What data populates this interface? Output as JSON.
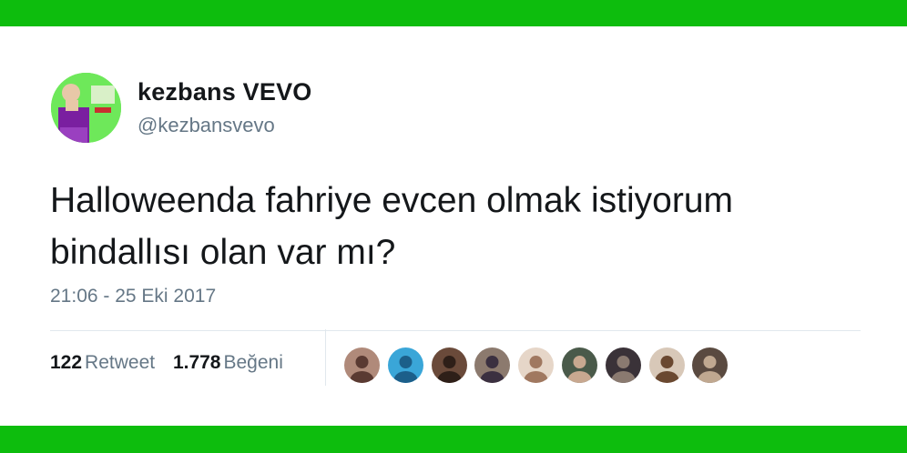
{
  "colors": {
    "band": "#0dbd0d",
    "text_primary": "#14171a",
    "text_secondary": "#657786",
    "divider": "#e1e8ed"
  },
  "user": {
    "display_name": "kezbans VEVO",
    "handle": "@kezbansvevo",
    "avatar_icon": "profile-photo"
  },
  "tweet": {
    "lines": [
      "Halloweenda fahriye evcen olmak istiyorum",
      "bindallısı olan var mı?"
    ],
    "timestamp": "21:06 - 25 Eki 2017"
  },
  "stats": {
    "retweets_count": "122",
    "retweets_label": "Retweet",
    "likes_count": "1.778",
    "likes_label": "Beğeni"
  },
  "likers": [
    {
      "name": "liker-avatar-1",
      "bg": "#b08a7a",
      "fg": "#5a3a32"
    },
    {
      "name": "liker-avatar-2",
      "bg": "#3aa6d8",
      "fg": "#1c5f8a"
    },
    {
      "name": "liker-avatar-3",
      "bg": "#6a4a3a",
      "fg": "#2e1f18"
    },
    {
      "name": "liker-avatar-4",
      "bg": "#8c7a6e",
      "fg": "#3b3040"
    },
    {
      "name": "liker-avatar-5",
      "bg": "#e6d6c8",
      "fg": "#a07860"
    },
    {
      "name": "liker-avatar-6",
      "bg": "#4a5a4a",
      "fg": "#c8a890"
    },
    {
      "name": "liker-avatar-7",
      "bg": "#3a3238",
      "fg": "#8a7a70"
    },
    {
      "name": "liker-avatar-8",
      "bg": "#d8c8b8",
      "fg": "#6a4830"
    },
    {
      "name": "liker-avatar-9",
      "bg": "#5a4a40",
      "fg": "#c0a890"
    }
  ]
}
